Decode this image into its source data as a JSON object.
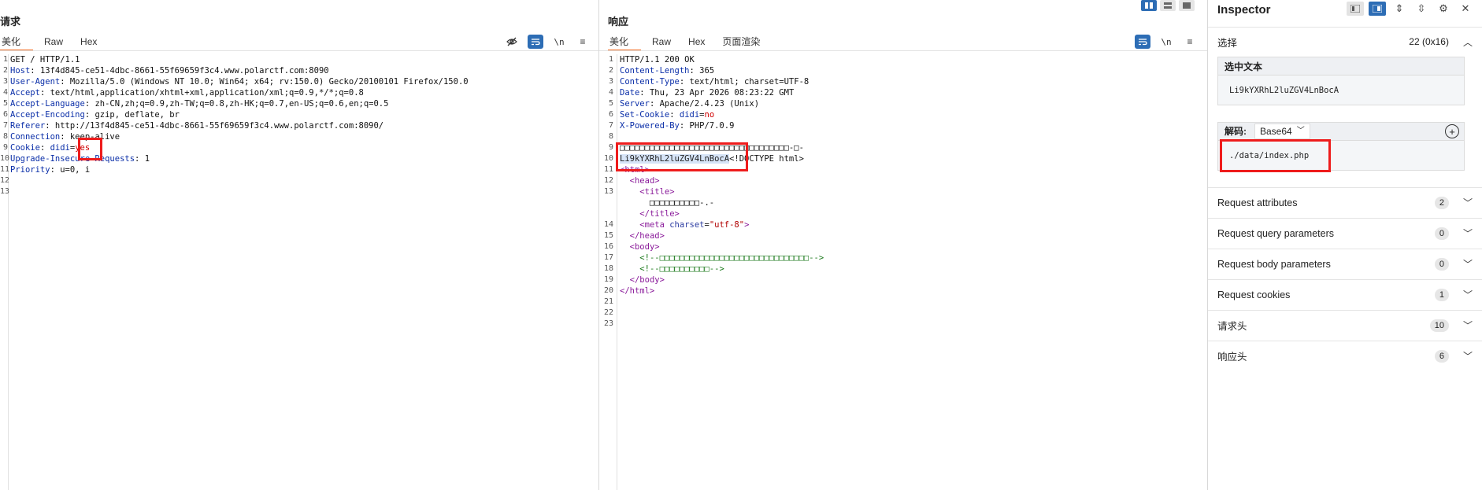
{
  "request": {
    "title": "请求",
    "tabs": [
      "美化",
      "Raw",
      "Hex"
    ],
    "lines": [
      {
        "n": "1",
        "parts": [
          [
            "v",
            "GET / HTTP/1.1"
          ]
        ]
      },
      {
        "n": "2",
        "parts": [
          [
            "k",
            "Host"
          ],
          [
            "v",
            ": 13f4d845-ce51-4dbc-8661-55f69659f3c4.www.polarctf.com:8090"
          ]
        ]
      },
      {
        "n": "3",
        "parts": [
          [
            "k",
            "User-Agent"
          ],
          [
            "v",
            ": Mozilla/5.0 (Windows NT 10.0; Win64; x64; rv:150.0) Gecko/20100101 Firefox/150.0"
          ]
        ]
      },
      {
        "n": "4",
        "parts": [
          [
            "k",
            "Accept"
          ],
          [
            "v",
            ": text/html,application/xhtml+xml,application/xml;q=0.9,*/*;q=0.8"
          ]
        ]
      },
      {
        "n": "5",
        "parts": [
          [
            "k",
            "Accept-Language"
          ],
          [
            "v",
            ": zh-CN,zh;q=0.9,zh-TW;q=0.8,zh-HK;q=0.7,en-US;q=0.6,en;q=0.5"
          ]
        ]
      },
      {
        "n": "6",
        "parts": [
          [
            "k",
            "Accept-Encoding"
          ],
          [
            "v",
            ": gzip, deflate, br"
          ]
        ]
      },
      {
        "n": "7",
        "parts": [
          [
            "k",
            "Referer"
          ],
          [
            "v",
            ": http://13f4d845-ce51-4dbc-8661-55f69659f3c4.www.polarctf.com:8090/"
          ]
        ]
      },
      {
        "n": "8",
        "parts": [
          [
            "k",
            "Connection"
          ],
          [
            "v",
            ": keep-alive"
          ]
        ]
      },
      {
        "n": "9",
        "parts": [
          [
            "k",
            "Cookie"
          ],
          [
            "v",
            ": "
          ],
          [
            "k",
            "didi"
          ],
          [
            "v",
            "="
          ],
          [
            "red",
            "yes"
          ]
        ]
      },
      {
        "n": "10",
        "parts": [
          [
            "k",
            "Upgrade-Insecure-Requests"
          ],
          [
            "v",
            ": 1"
          ]
        ]
      },
      {
        "n": "11",
        "parts": [
          [
            "k",
            "Priority"
          ],
          [
            "v",
            ": u=0, i"
          ]
        ]
      },
      {
        "n": "12",
        "parts": []
      },
      {
        "n": "13",
        "parts": []
      }
    ]
  },
  "response": {
    "title": "响应",
    "tabs": [
      "美化",
      "Raw",
      "Hex",
      "页面渲染"
    ],
    "lines": [
      {
        "n": "1",
        "parts": [
          [
            "v",
            "HTTP/1.1 200 OK"
          ]
        ]
      },
      {
        "n": "2",
        "parts": [
          [
            "k",
            "Content-Length"
          ],
          [
            "v",
            ": 365"
          ]
        ]
      },
      {
        "n": "3",
        "parts": [
          [
            "k",
            "Content-Type"
          ],
          [
            "v",
            ": text/html; charset=UTF-8"
          ]
        ]
      },
      {
        "n": "4",
        "parts": [
          [
            "k",
            "Date"
          ],
          [
            "v",
            ": Thu, 23 Apr 2026 08:23:22 GMT"
          ]
        ]
      },
      {
        "n": "5",
        "parts": [
          [
            "k",
            "Server"
          ],
          [
            "v",
            ": Apache/2.4.23 (Unix)"
          ]
        ]
      },
      {
        "n": "6",
        "parts": [
          [
            "k",
            "Set-Cookie"
          ],
          [
            "v",
            ": "
          ],
          [
            "k",
            "didi"
          ],
          [
            "v",
            "="
          ],
          [
            "red",
            "no"
          ]
        ]
      },
      {
        "n": "7",
        "parts": [
          [
            "k",
            "X-Powered-By"
          ],
          [
            "v",
            ": PHP/7.0.9"
          ]
        ]
      },
      {
        "n": "8",
        "parts": []
      },
      {
        "n": "9",
        "parts": [
          [
            "v",
            "□□□□□□□□□□□□□□□□□□□□□□□□□□□□□□□□□□-□-"
          ]
        ]
      },
      {
        "n": "10",
        "parts": [
          [
            "hl",
            "Li9kYXRhL2luZGV4LnBocA"
          ],
          [
            "v",
            "<!DOCTYPE html>"
          ]
        ]
      },
      {
        "n": "11",
        "parts": [
          [
            "tag",
            "<html>"
          ]
        ]
      },
      {
        "n": "12",
        "parts": [
          [
            "v",
            "  "
          ],
          [
            "tag",
            "<head>"
          ]
        ]
      },
      {
        "n": "13",
        "parts": [
          [
            "v",
            "    "
          ],
          [
            "tag",
            "<title>"
          ]
        ]
      },
      {
        "n": "",
        "parts": [
          [
            "v",
            "      □□□□□□□□□□-.-"
          ]
        ]
      },
      {
        "n": "",
        "parts": [
          [
            "v",
            "    "
          ],
          [
            "tag",
            "</title>"
          ]
        ]
      },
      {
        "n": "14",
        "parts": [
          [
            "v",
            "    "
          ],
          [
            "tag",
            "<meta "
          ],
          [
            "attr",
            "charset"
          ],
          [
            "v",
            "="
          ],
          [
            "str",
            "\"utf-8\""
          ],
          [
            "tag",
            ">"
          ]
        ]
      },
      {
        "n": "15",
        "parts": [
          [
            "v",
            "  "
          ],
          [
            "tag",
            "</head>"
          ]
        ]
      },
      {
        "n": "16",
        "parts": [
          [
            "v",
            "  "
          ],
          [
            "tag",
            "<body>"
          ]
        ]
      },
      {
        "n": "17",
        "parts": [
          [
            "v",
            "    "
          ],
          [
            "cmt",
            "<!--□□□□□□□□□□□□□□□□□□□□□□□□□□□□□□-->"
          ]
        ]
      },
      {
        "n": "18",
        "parts": [
          [
            "v",
            "    "
          ],
          [
            "cmt",
            "<!--□□□□□□□□□□-->"
          ]
        ]
      },
      {
        "n": "19",
        "parts": [
          [
            "v",
            "  "
          ],
          [
            "tag",
            "</body>"
          ]
        ]
      },
      {
        "n": "20",
        "parts": [
          [
            "tag",
            "</html>"
          ]
        ]
      },
      {
        "n": "21",
        "parts": []
      },
      {
        "n": "22",
        "parts": []
      },
      {
        "n": "23",
        "parts": []
      }
    ]
  },
  "inspector": {
    "title": "Inspector",
    "selection_label": "选择",
    "selection_count": "22 (0x16)",
    "selected_text_label": "选中文本",
    "selected_text": "Li9kYXRhL2luZGV4LnBocA",
    "decode_label": "解码:",
    "decode_type": "Base64",
    "decoded_text": "./data/index.php",
    "rows": [
      {
        "label": "Request attributes",
        "count": "2"
      },
      {
        "label": "Request query parameters",
        "count": "0"
      },
      {
        "label": "Request body parameters",
        "count": "0"
      },
      {
        "label": "Request cookies",
        "count": "1"
      },
      {
        "label": "请求头",
        "count": "10"
      },
      {
        "label": "响应头",
        "count": "6"
      }
    ]
  },
  "icons": {
    "request_tools": [
      "eye-off-icon",
      "wrap-icon",
      "newline-icon",
      "menu-icon"
    ],
    "response_tools": [
      "wrap-icon",
      "newline-icon",
      "menu-icon"
    ],
    "layout_buttons": [
      "split-columns-icon",
      "split-rows-icon",
      "single-pane-icon"
    ]
  },
  "colors": {
    "accent": "#f26b21",
    "active_blue": "#2d6db5",
    "highlight_red": "#ee1c1c"
  }
}
